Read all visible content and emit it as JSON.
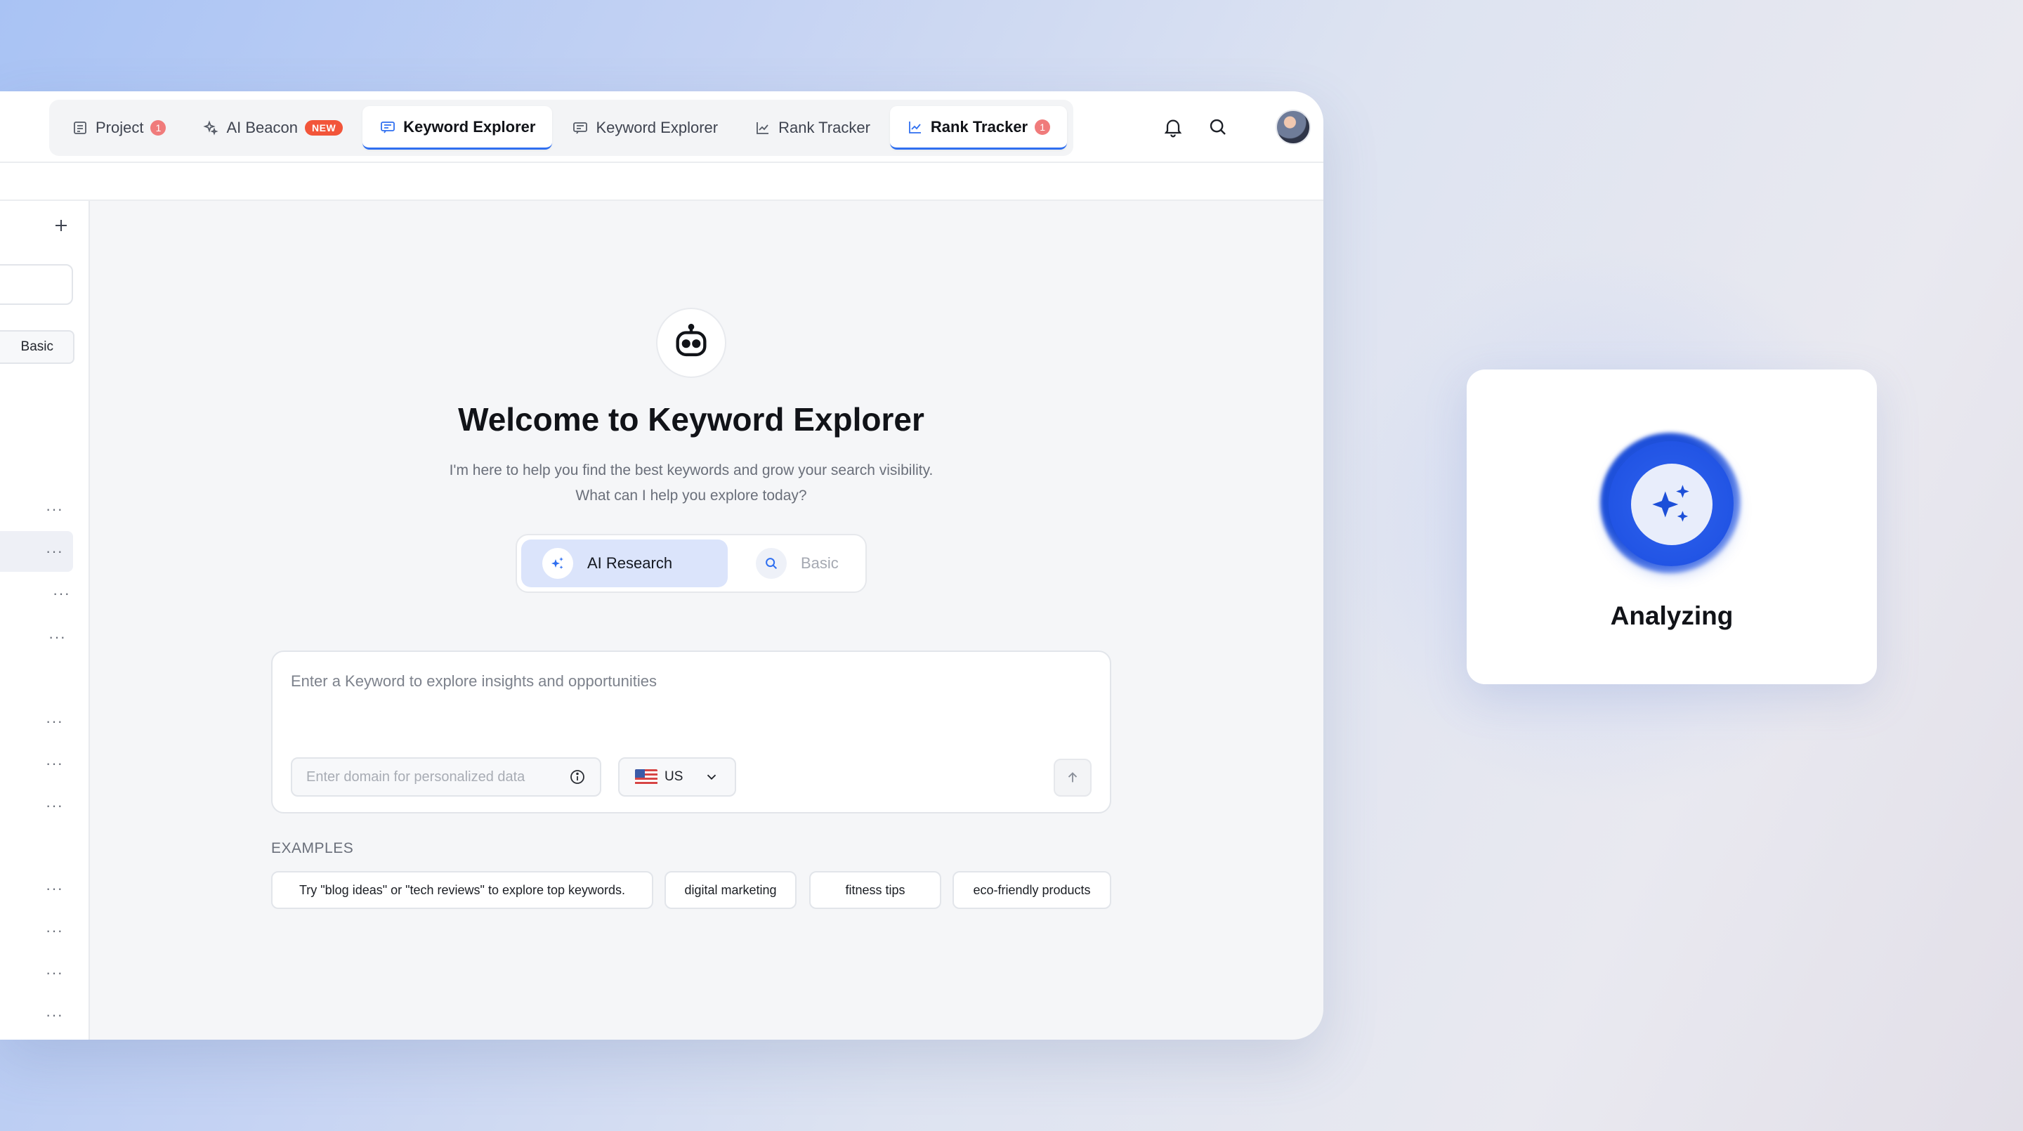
{
  "tabs": [
    {
      "label": "Project",
      "badge": "1"
    },
    {
      "label": "AI Beacon",
      "badge": "NEW"
    },
    {
      "label": "Keyword Explorer"
    },
    {
      "label": "Keyword Explorer"
    },
    {
      "label": "Rank Tracker"
    },
    {
      "label": "Rank Tracker",
      "badge": "1"
    }
  ],
  "sidebar": {
    "basic_label": "Basic",
    "more_glyph": "···"
  },
  "welcome": {
    "title": "Welcome to Keyword Explorer",
    "subtitle_line1": "I'm here to help you find the best keywords and grow your search visibility.",
    "subtitle_line2": "What can I help you explore today?"
  },
  "modes": {
    "ai": "AI Research",
    "basic": "Basic",
    "selected": "ai"
  },
  "search": {
    "keyword_placeholder": "Enter a Keyword to explore insights and opportunities",
    "domain_placeholder": "Enter domain for personalized data",
    "country": "US"
  },
  "examples": {
    "label": "EXAMPLES",
    "items": [
      "Try \"blog ideas\" or \"tech reviews\" to explore top keywords.",
      "digital marketing",
      "fitness tips",
      "eco-friendly products"
    ]
  },
  "analyzing": {
    "label": "Analyzing"
  },
  "colors": {
    "accent": "#2f6ff0",
    "badge_red": "#f07b7b",
    "badge_new": "#f2553a",
    "ai_mode_bg": "#dbe4fb",
    "orb_blue": "#1d4fd8"
  },
  "icons": [
    "project-icon",
    "ai-beacon-icon",
    "keyword-explorer-icon",
    "rank-tracker-icon",
    "bell-icon",
    "search-icon",
    "plus-icon",
    "robot-icon",
    "sparkle-icon",
    "info-icon",
    "chevron-down-icon",
    "arrow-up-icon"
  ]
}
